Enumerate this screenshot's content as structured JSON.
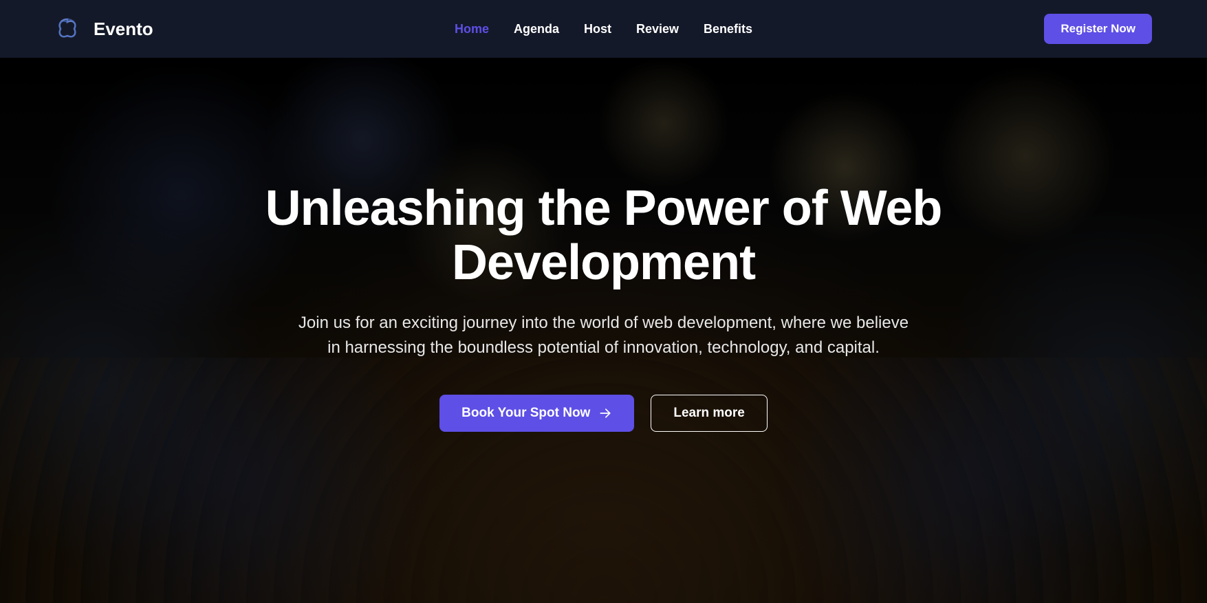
{
  "header": {
    "brand": "Evento",
    "nav": [
      {
        "label": "Home",
        "active": true
      },
      {
        "label": "Agenda",
        "active": false
      },
      {
        "label": "Host",
        "active": false
      },
      {
        "label": "Review",
        "active": false
      },
      {
        "label": "Benefits",
        "active": false
      }
    ],
    "register_btn": "Register Now"
  },
  "hero": {
    "title": "Unleashing the Power of Web Development",
    "subtitle": "Join us for an exciting journey into the world of web development, where we believe in harnessing the boundless potential of innovation, technology, and capital.",
    "primary_btn": "Book Your Spot Now",
    "secondary_btn": "Learn more"
  },
  "colors": {
    "accent": "#5e4fe6",
    "header_bg": "#141929",
    "body_bg": "#0f1420"
  }
}
